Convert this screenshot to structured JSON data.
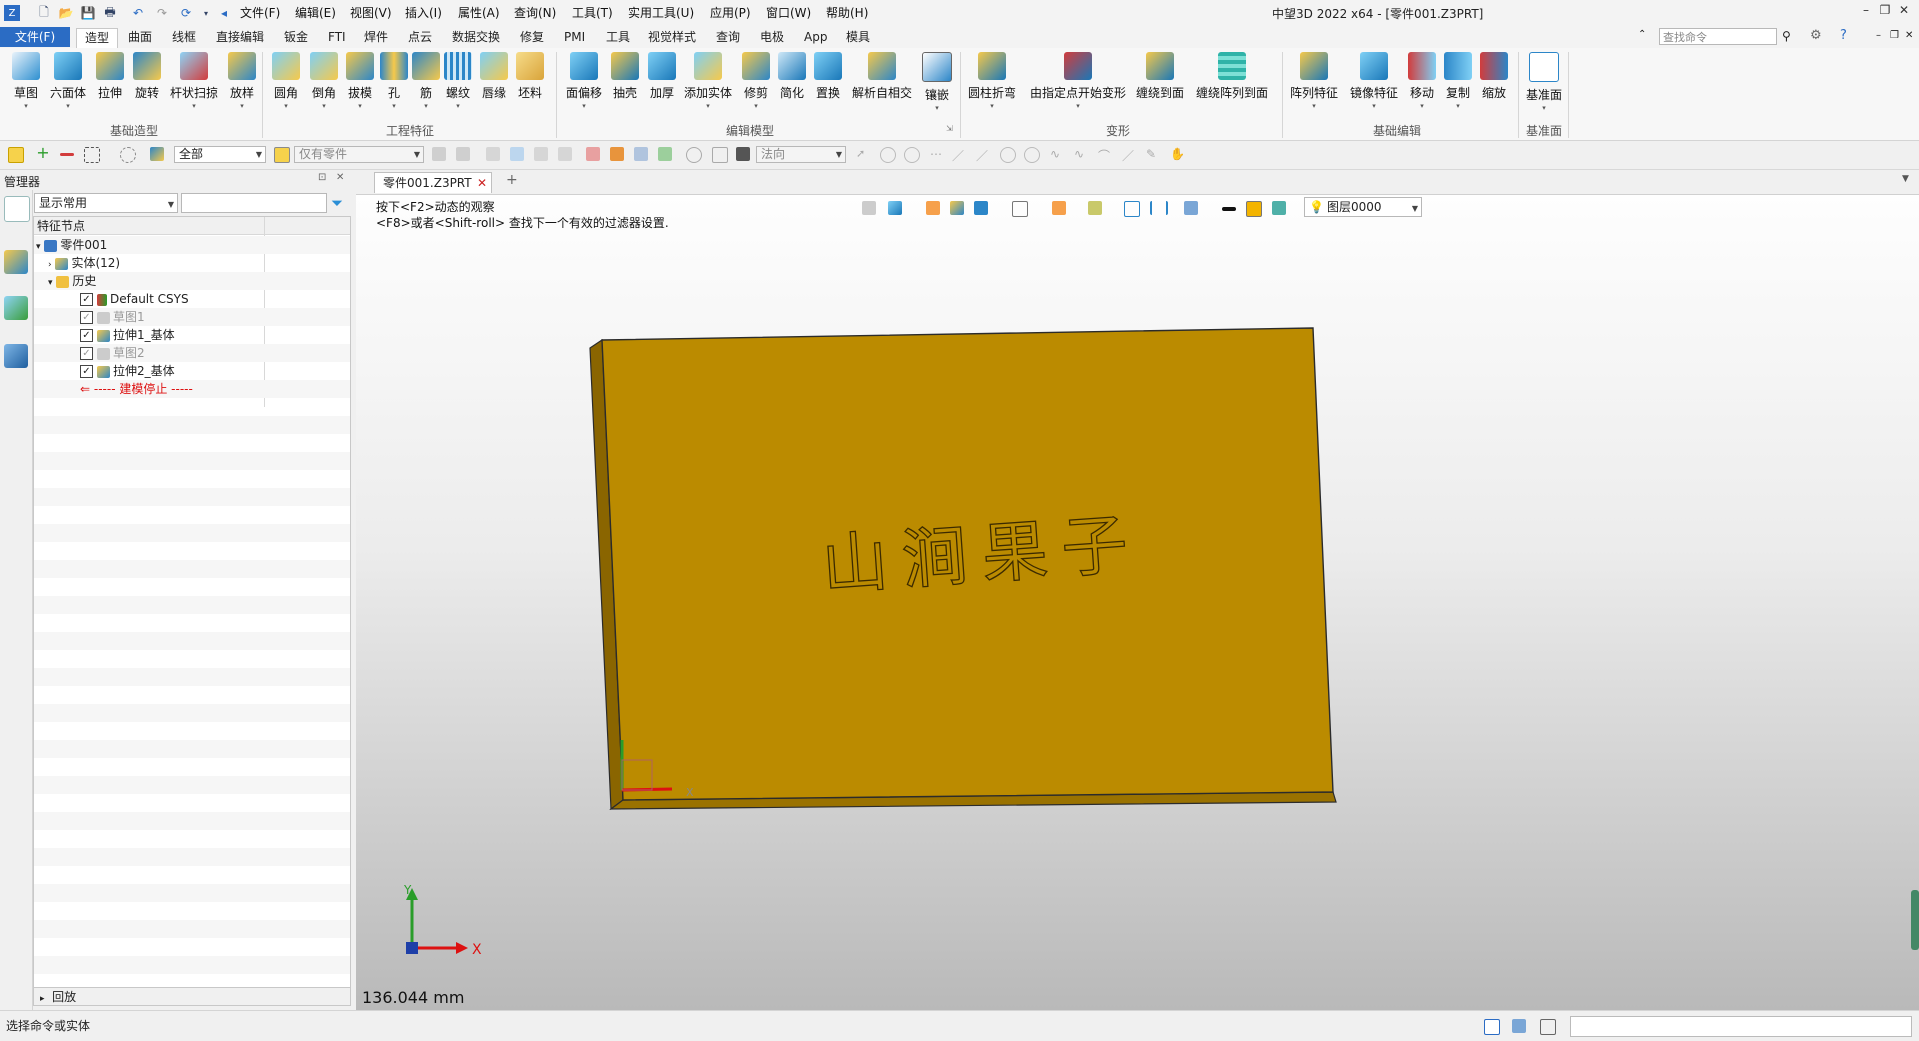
{
  "window": {
    "title": "中望3D 2022 x64 - [零件001.Z3PRT]"
  },
  "menu": [
    "文件(F)",
    "编辑(E)",
    "视图(V)",
    "插入(I)",
    "属性(A)",
    "查询(N)",
    "工具(T)",
    "实用工具(U)",
    "应用(P)",
    "窗口(W)",
    "帮助(H)"
  ],
  "ribbon_tabs": {
    "file": "文件(F)",
    "items": [
      "造型",
      "曲面",
      "线框",
      "直接编辑",
      "钣金",
      "FTI",
      "焊件",
      "点云",
      "数据交换",
      "修复",
      "PMI",
      "工具",
      "视觉样式",
      "查询",
      "电极",
      "App",
      "模具"
    ],
    "active": "造型"
  },
  "search": {
    "placeholder": "查找命令"
  },
  "ribbon": {
    "groups": [
      {
        "name": "基础造型",
        "buttons": [
          "草图",
          "六面体",
          "拉伸",
          "旋转",
          "杆状扫掠",
          "放样"
        ]
      },
      {
        "name": "工程特征",
        "buttons": [
          "圆角",
          "倒角",
          "拔模",
          "孔",
          "筋",
          "螺纹",
          "唇缘",
          "坯料"
        ]
      },
      {
        "name": "编辑模型",
        "buttons": [
          "面偏移",
          "抽壳",
          "加厚",
          "添加实体",
          "修剪",
          "简化",
          "置换",
          "解析自相交",
          "镶嵌"
        ]
      },
      {
        "name": "变形",
        "buttons": [
          "圆柱折弯",
          "由指定点开始变形",
          "缠绕到面",
          "缠绕阵列到面"
        ]
      },
      {
        "name": "基础编辑",
        "buttons": [
          "阵列特征",
          "镜像特征",
          "移动",
          "复制",
          "缩放"
        ]
      },
      {
        "name": "基准面",
        "buttons": [
          "基准面"
        ]
      }
    ]
  },
  "toolbar2": {
    "filter_all": "全部",
    "filter_part": "仅有零件",
    "direction": "法向"
  },
  "manager": {
    "title": "管理器",
    "display_combo": "显示常用",
    "column_header": "特征节点",
    "tree": [
      {
        "label": "零件001",
        "level": 0
      },
      {
        "label": "实体(12)",
        "level": 1
      },
      {
        "label": "历史",
        "level": 1
      },
      {
        "label": "Default CSYS",
        "level": 2
      },
      {
        "label": "草图1",
        "level": 2
      },
      {
        "label": "拉伸1_基体",
        "level": 2
      },
      {
        "label": "草图2",
        "level": 2
      },
      {
        "label": "拉伸2_基体",
        "level": 2
      },
      {
        "label": "----- 建模停止 -----",
        "level": 2
      }
    ],
    "playback": "回放"
  },
  "document": {
    "tab": "零件001.Z3PRT",
    "hint1": "按下<F2>动态的观察",
    "hint2": "<F8>或者<Shift-roll> 查找下一个有效的过滤器设置.",
    "layer": "图层0000",
    "measure": "136.044 mm"
  },
  "model": {
    "engraved_text": "山涧果子",
    "face_color": "#BB8B00",
    "side_color": "#8A6500"
  },
  "axes": {
    "x": "X",
    "y": "Y"
  },
  "status": {
    "message": "选择命令或实体"
  },
  "colors": {
    "accent": "#2b6cc4",
    "model": "#BB8B00"
  }
}
